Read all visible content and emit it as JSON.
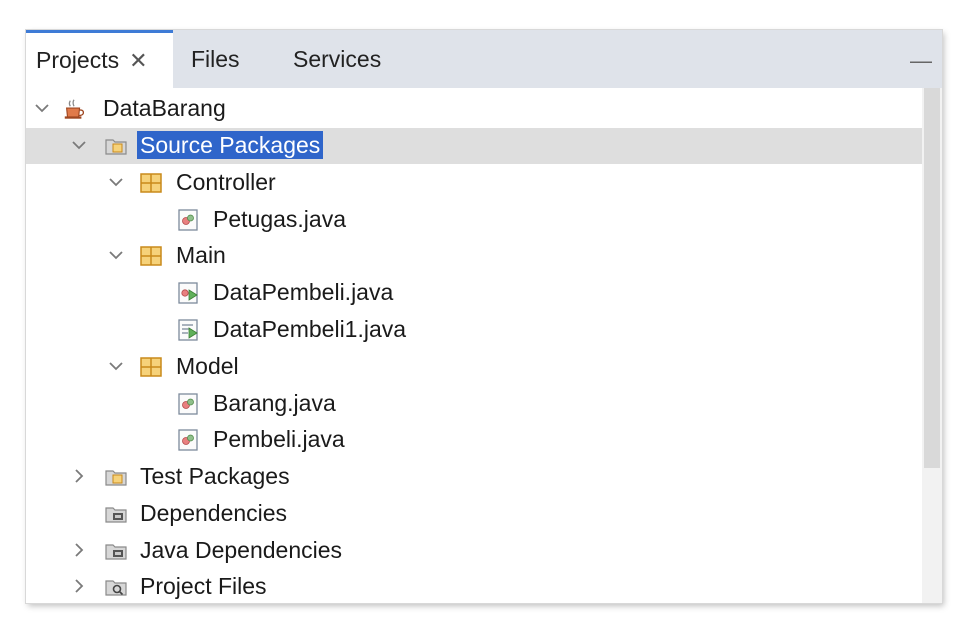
{
  "tabs": [
    {
      "label": "Projects",
      "close": "✕"
    },
    {
      "label": "Files"
    },
    {
      "label": "Services"
    }
  ],
  "minimize_glyph": "—",
  "tree": {
    "project": "DataBarang",
    "source_packages": "Source Packages",
    "controller": "Controller",
    "petugas": "Petugas.java",
    "main": "Main",
    "datapembeli": "DataPembeli.java",
    "datapembeli1": "DataPembeli1.java",
    "model": "Model",
    "barang": "Barang.java",
    "pembeli": "Pembeli.java",
    "test_packages": "Test Packages",
    "dependencies": "Dependencies",
    "java_dependencies": "Java Dependencies",
    "project_files": "Project Files"
  },
  "colors": {
    "selection": "#2f65ca",
    "row_highlight": "#dedede",
    "package": "#e5a43b",
    "tab_accent": "#3e7bd6"
  }
}
